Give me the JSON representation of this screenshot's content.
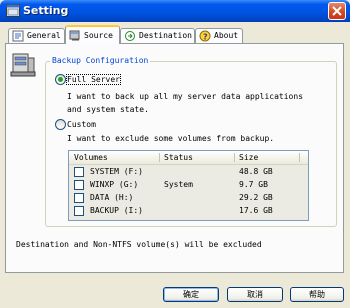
{
  "window": {
    "title": "Setting"
  },
  "tabs": [
    {
      "label": "General",
      "icon": "general-icon",
      "active": false
    },
    {
      "label": "Source",
      "icon": "source-icon",
      "active": true
    },
    {
      "label": "Destination",
      "icon": "destination-icon",
      "active": false
    },
    {
      "label": "About",
      "icon": "about-icon",
      "active": false
    }
  ],
  "backup": {
    "group_title": "Backup Configuration",
    "full_server": {
      "label": "Full Server",
      "description_line1": "I want to back up all my server data applications",
      "description_line2": "and system state.",
      "selected": true
    },
    "custom": {
      "label": "Custom",
      "description": "I want to exclude some volumes from backup.",
      "selected": false
    },
    "volumes_table": {
      "columns": [
        "Volumes",
        "Status",
        "Size"
      ],
      "rows": [
        {
          "volume": "SYSTEM  (F:)",
          "status": "",
          "size": "48.8 GB",
          "checked": false
        },
        {
          "volume": "WINXP  (G:)",
          "status": "System",
          "size": "9.7 GB",
          "checked": false
        },
        {
          "volume": "DATA  (H:)",
          "status": "",
          "size": "29.2 GB",
          "checked": false
        },
        {
          "volume": "BACKUP  (I:)",
          "status": "",
          "size": "17.6 GB",
          "checked": false
        }
      ]
    }
  },
  "footer_note": "Destination and Non-NTFS volume(s) will be excluded",
  "buttons": {
    "ok": "确定",
    "cancel": "取消",
    "help": "帮助"
  },
  "colors": {
    "titlebar": "#0054e3",
    "group_title": "#0046d5",
    "active_tab_highlight": "#ffc83c",
    "radio_dot": "#21a121"
  }
}
